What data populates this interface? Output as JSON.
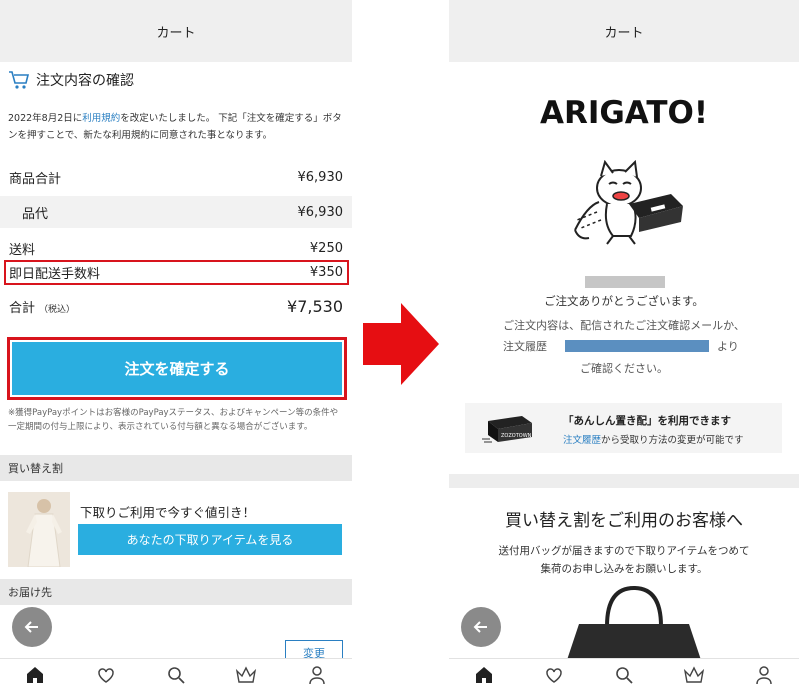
{
  "left": {
    "title": "カート",
    "section_title": "注文内容の確認",
    "notice": {
      "pre": "2022年8月2日に",
      "link": "利用規約",
      "post": "を改定いたしました。 下記「注文を確定する」ボタンを押すことで、新たな利用規約に同意された事となります。"
    },
    "rows": [
      {
        "label": "商品合計",
        "value": "¥6,930"
      },
      {
        "label": "品代",
        "value": "¥6,930"
      },
      {
        "label": "送料",
        "value": "¥250"
      },
      {
        "label": "即日配送手数料",
        "value": "¥350"
      }
    ],
    "total": {
      "label": "合計",
      "tax_note": "（税込）",
      "value": "¥7,530"
    },
    "confirm_button": "注文を確定する",
    "fine_print": "※獲得PayPayポイントはお客様のPayPayステータス、およびキャンペーン等の条件や一定期間の付与上限により、表示されている付与額と異なる場合がございます。",
    "tradein_band": "買い替え割",
    "tradein_text": "下取りご利用で今すぐ値引き！",
    "tradein_button": "あなたの下取りアイテムを見る",
    "delivery_band": "お届け先",
    "change_button": "変更"
  },
  "right": {
    "title": "カート",
    "headline": "ARIGATO!",
    "thanks": "ご注文ありがとうございます。",
    "msg1": "ご注文内容は、配信されたご注文確認メールか、",
    "msg2_pre": "注文履歴",
    "msg2_post": "より",
    "msg3": "ご確認ください。",
    "anshin_title": "「あんしん置き配」を利用できます",
    "anshin_link": "注文履歴",
    "anshin_rest": "から受取り方法の変更が可能です",
    "anshin_box_label": "ZOZOTOWN",
    "kaikae_title": "買い替え割をご利用のお客様へ",
    "kaikae_d1": "送付用バッグが届きますので下取りアイテムをつめて",
    "kaikae_d2": "集荷のお申し込みをお願いします。"
  },
  "nav_icons": [
    "home-icon",
    "heart-icon",
    "search-icon",
    "crown-icon",
    "user-icon"
  ],
  "colors": {
    "accent": "#2aaee0",
    "highlight": "#d8141d",
    "link": "#2a7fc2"
  }
}
